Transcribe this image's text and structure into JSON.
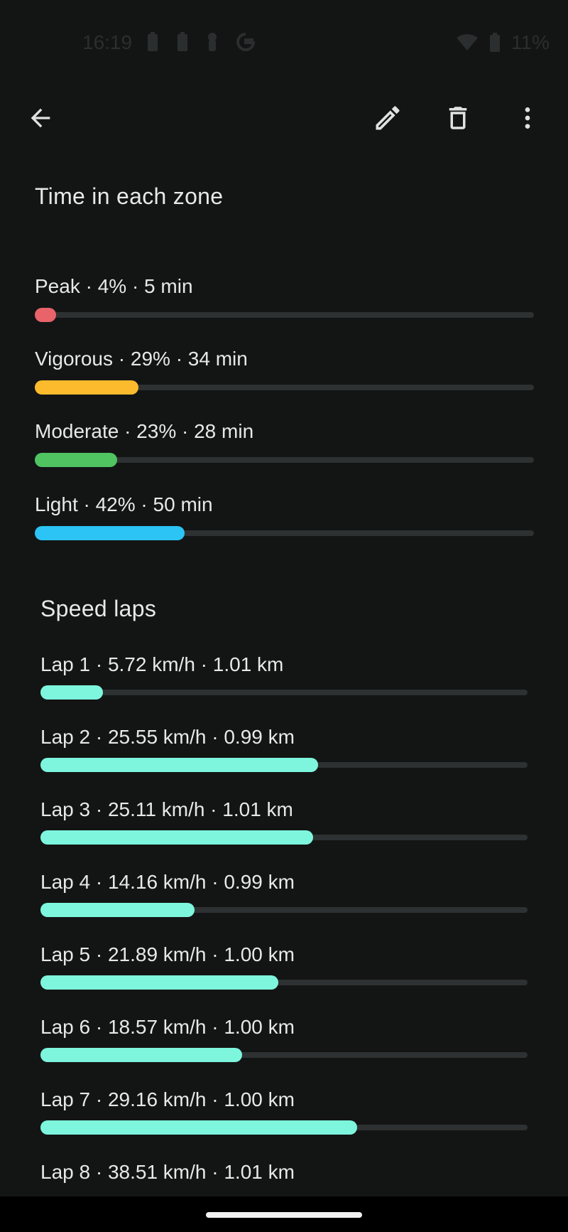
{
  "status_bar": {
    "time": "16:19",
    "battery_text": "11%",
    "icons": [
      "battery-icon",
      "battery-icon",
      "person-icon",
      "google-icon",
      "wifi-icon",
      "battery-charging-icon"
    ]
  },
  "toolbar": {
    "icons": [
      "back-arrow-icon",
      "edit-pencil-icon",
      "delete-trash-icon",
      "more-vert-icon"
    ]
  },
  "zones": {
    "title": "Time in each zone",
    "items": [
      {
        "label": "Peak · 4% · 5 min",
        "percent": 4,
        "color": "#e8636a"
      },
      {
        "label": "Vigorous · 29% · 34 min",
        "percent": 29,
        "color": "#fbbb2d"
      },
      {
        "label": "Moderate · 23% · 28 min",
        "percent": 23,
        "color": "#4fc461"
      },
      {
        "label": "Light · 42% · 50 min",
        "percent": 42,
        "color": "#2bc4f5"
      }
    ]
  },
  "laps": {
    "title": "Speed laps",
    "color": "#7df6dd",
    "max_speed": 38.51,
    "items": [
      {
        "label": "Lap 1 · 5.72 km/h · 1.01 km",
        "speed": 5.72
      },
      {
        "label": "Lap 2 · 25.55 km/h · 0.99 km",
        "speed": 25.55
      },
      {
        "label": "Lap 3 · 25.11 km/h · 1.01 km",
        "speed": 25.11
      },
      {
        "label": "Lap 4 · 14.16 km/h · 0.99 km",
        "speed": 14.16
      },
      {
        "label": "Lap 5 · 21.89 km/h · 1.00 km",
        "speed": 21.89
      },
      {
        "label": "Lap 6 · 18.57 km/h · 1.00 km",
        "speed": 18.57
      },
      {
        "label": "Lap 7 · 29.16 km/h · 1.00 km",
        "speed": 29.16
      },
      {
        "label": "Lap 8 · 38.51 km/h · 1.01 km",
        "speed": 38.51
      }
    ]
  }
}
